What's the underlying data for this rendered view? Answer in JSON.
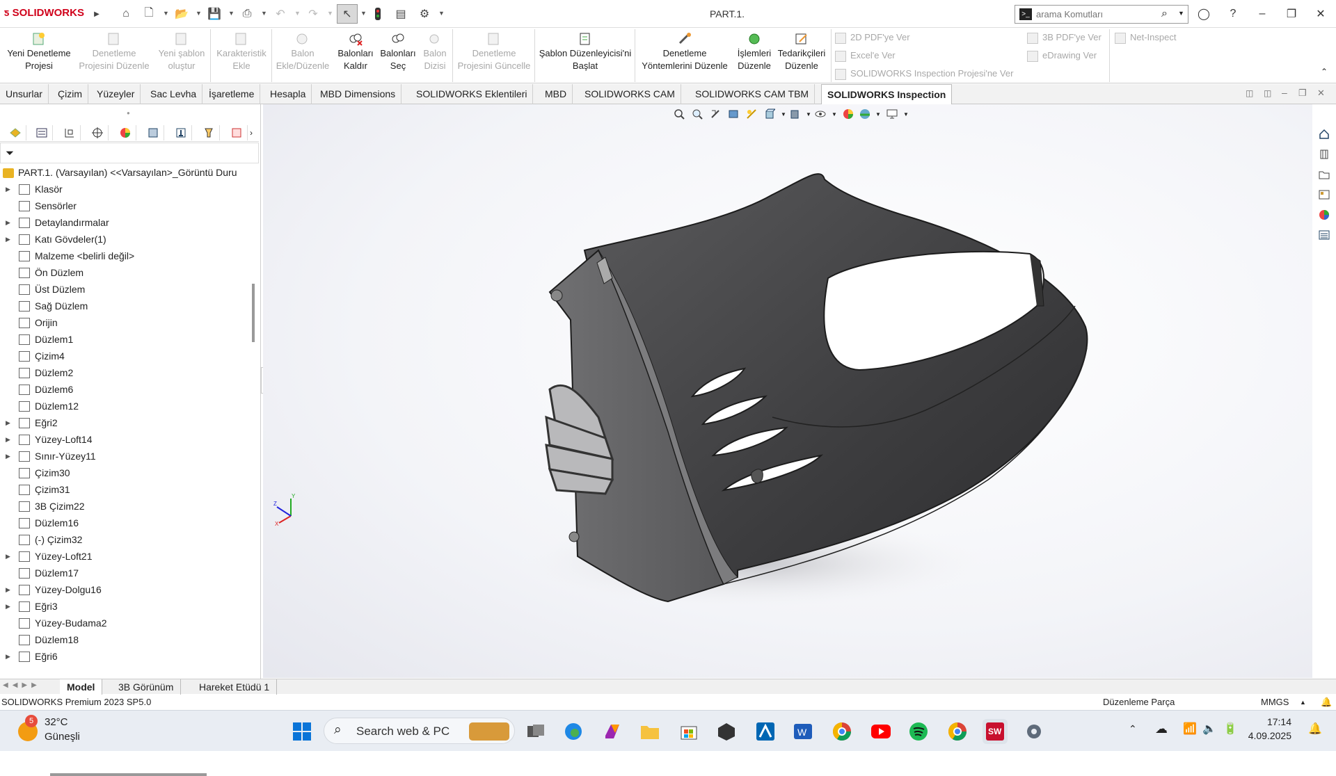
{
  "app": {
    "logo": "SOLIDWORKS",
    "title": "PART.1."
  },
  "search": {
    "placeholder": "arama Komutları"
  },
  "ribbon": {
    "new_project": "Yeni Denetleme Projesi",
    "edit_project": "Denetleme Projesini Düzenle",
    "new_template": "Yeni şablon oluştur",
    "add_char": "Karakteristik Ekle",
    "add_balloon": "Balon Ekle/Düzenle",
    "remove_balloons": "Balonları Kaldır",
    "select_balloons": "Balonları Seç",
    "balloon_array": "Balon Dizisi",
    "update_project": "Denetleme Projesini Güncelle",
    "template_editor": "Şablon Düzenleyicisi'ni Başlat",
    "edit_methods": "Denetleme Yöntemlerini Düzenle",
    "edit_operations": "İşlemleri Düzenle",
    "edit_vendors": "Tedarikçileri Düzenle",
    "export_2d_pdf": "2D PDF'ye Ver",
    "export_excel": "Excel'e Ver",
    "export_sw_project": "SOLIDWORKS Inspection Projesi'ne Ver",
    "export_3d_pdf": "3B PDF'ye Ver",
    "export_edrawing": "eDrawing Ver",
    "net_inspect": "Net-Inspect"
  },
  "tabs": [
    "Unsurlar",
    "Çizim",
    "Yüzeyler",
    "Sac Levha",
    "İşaretleme",
    "Hesapla",
    "MBD Dimensions",
    "SOLIDWORKS Eklentileri",
    "MBD",
    "SOLIDWORKS CAM",
    "SOLIDWORKS CAM TBM",
    "SOLIDWORKS Inspection"
  ],
  "tree": {
    "root": "PART.1. (Varsayılan) <<Varsayılan>_Görüntü Duru",
    "items": [
      "Klasör",
      "Sensörler",
      "Detaylandırmalar",
      "Katı Gövdeler(1)",
      "Malzeme <belirli değil>",
      "Ön Düzlem",
      "Üst Düzlem",
      "Sağ Düzlem",
      "Orijin",
      "Düzlem1",
      "Çizim4",
      "Düzlem2",
      "Düzlem6",
      "Düzlem12",
      "Eğri2",
      "Yüzey-Loft14",
      "Sınır-Yüzey11",
      "Çizim30",
      "Çizim31",
      "3B Çizim22",
      "Düzlem16",
      "(-) Çizim32",
      "Yüzey-Loft21",
      "Düzlem17",
      "Yüzey-Dolgu16",
      "Eğri3",
      "Yüzey-Budama2",
      "Düzlem18",
      "Eğri6"
    ]
  },
  "bottom_tabs": [
    "Model",
    "3B Görünüm",
    "Hareket Etüdü 1"
  ],
  "status": {
    "version": "SOLIDWORKS Premium 2023 SP5.0",
    "mode": "Düzenleme Parça",
    "units": "MMGS"
  },
  "taskbar": {
    "weather_temp": "32°C",
    "weather_desc": "Güneşli",
    "weather_badge": "5",
    "search": "Search web & PC",
    "time": "17:14",
    "date": "4.09.2025"
  },
  "triad": {
    "x": "X",
    "y": "Y",
    "z": "Z"
  }
}
